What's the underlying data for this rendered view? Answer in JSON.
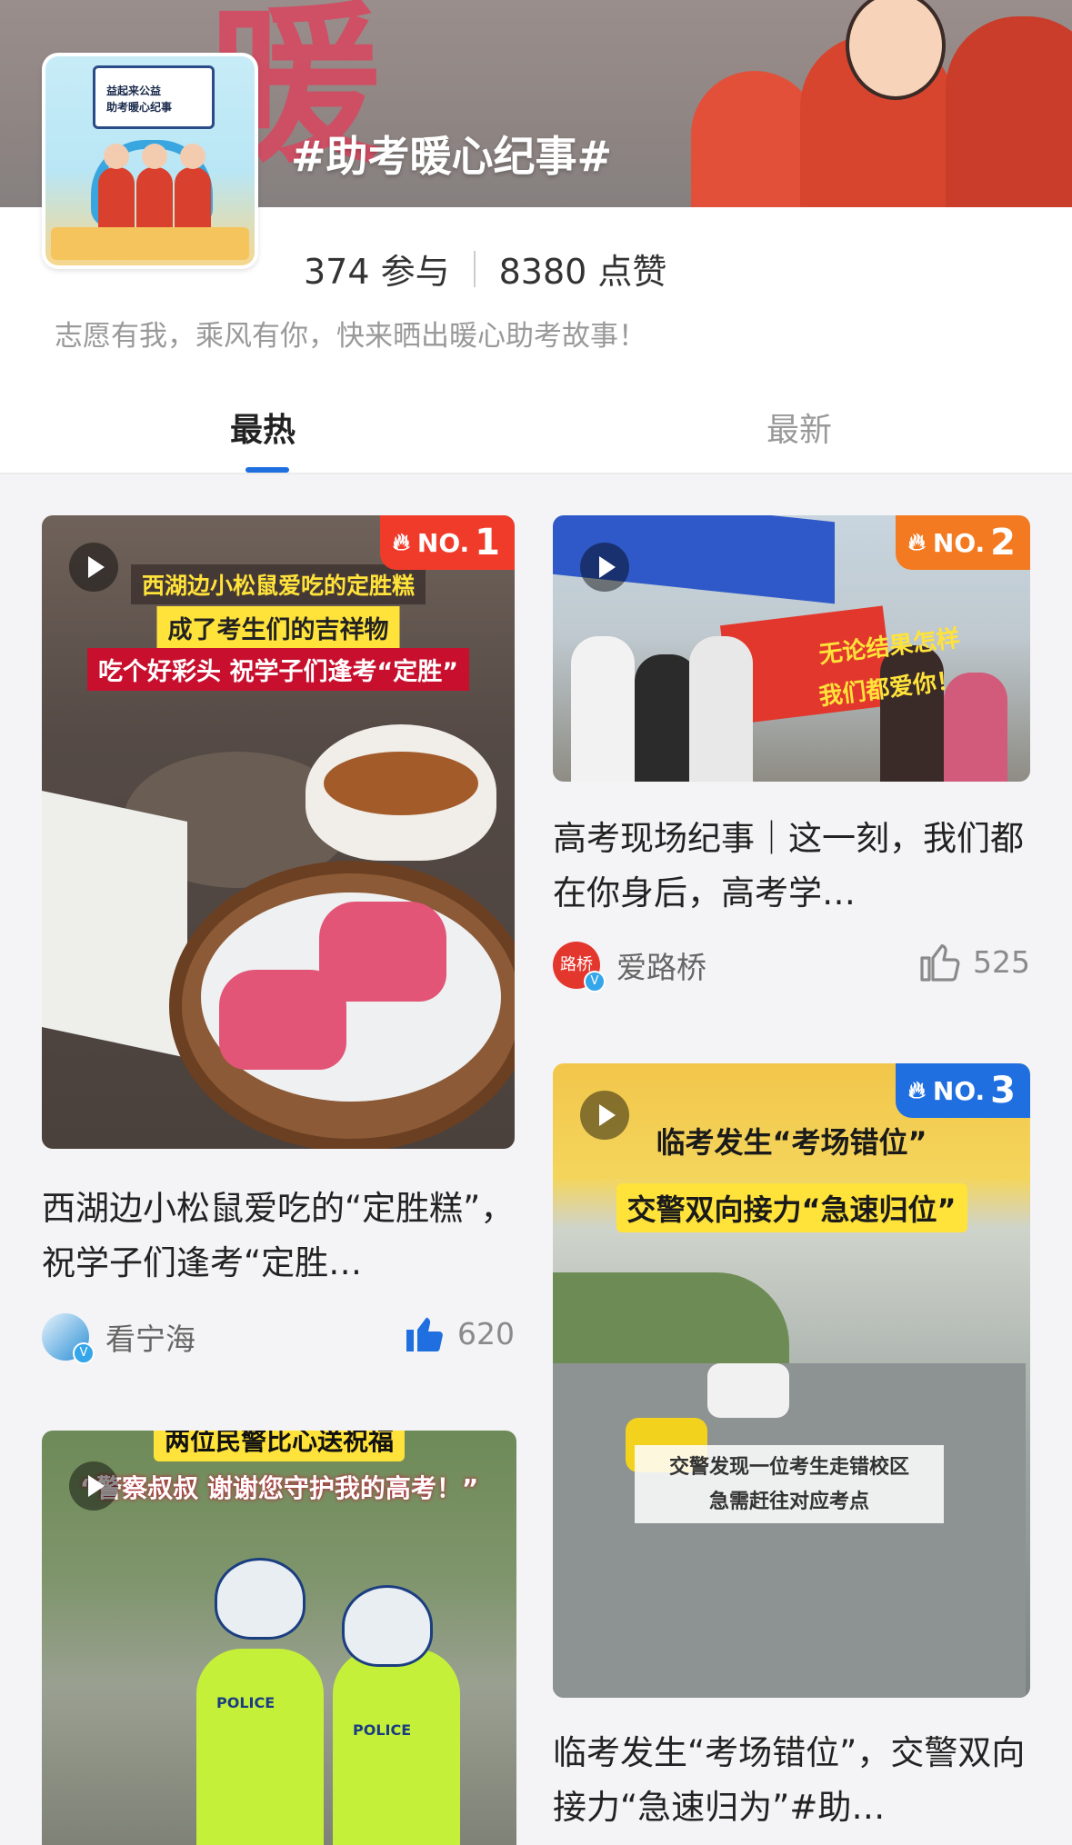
{
  "topic": {
    "title": "#助考暖心纪事#",
    "thumbnail_line1": "益起来公益",
    "thumbnail_line2": "助考暖心纪事",
    "participants": "374 参与",
    "likes": "8380 点赞",
    "description": "志愿有我，乘风有你，快来晒出暖心助考故事！"
  },
  "tabs": [
    {
      "label": "最热",
      "active": true
    },
    {
      "label": "最新",
      "active": false
    }
  ],
  "colors": {
    "accent_blue": "#1f6fe0",
    "rank1": "#f03b2b",
    "rank2": "#f47a21",
    "rank3": "#1f6fe0"
  },
  "cards": [
    {
      "rank_prefix": "NO.",
      "rank_num": "1",
      "overlay": [
        "西湖边小松鼠爱吃的定胜糕",
        "成了考生们的吉祥物",
        "吃个好彩头 祝学子们逢考“定胜”"
      ],
      "title": "西湖边小松鼠爱吃的“定胜糕”，祝学子们逢考“定胜…",
      "author": "看宁海",
      "likes": "620",
      "liked": true
    },
    {
      "rank_prefix": "NO.",
      "rank_num": "2",
      "overlay": [
        "无论结果怎样",
        "我们都爱你！"
      ],
      "title": "高考现场纪事｜这一刻，我们都在你身后，高考学…",
      "author": "爱路桥",
      "avatar_text": "路桥",
      "likes": "525",
      "liked": false
    },
    {
      "rank_prefix": "NO.",
      "rank_num": "3",
      "overlay": [
        "临考发生“考场错位”",
        "交警双向接力“急速归位”",
        "交警发现一位考生走错校区",
        "急需赶往对应考点"
      ],
      "title": "临考发生“考场错位”，交警双向接力“急速归为”#助…"
    },
    {
      "overlay": [
        "两位民警比心送祝福",
        "“警察叔叔 谢谢您守护我的高考！”"
      ],
      "officer_labels": [
        "POLICE",
        "POLICE"
      ]
    }
  ]
}
